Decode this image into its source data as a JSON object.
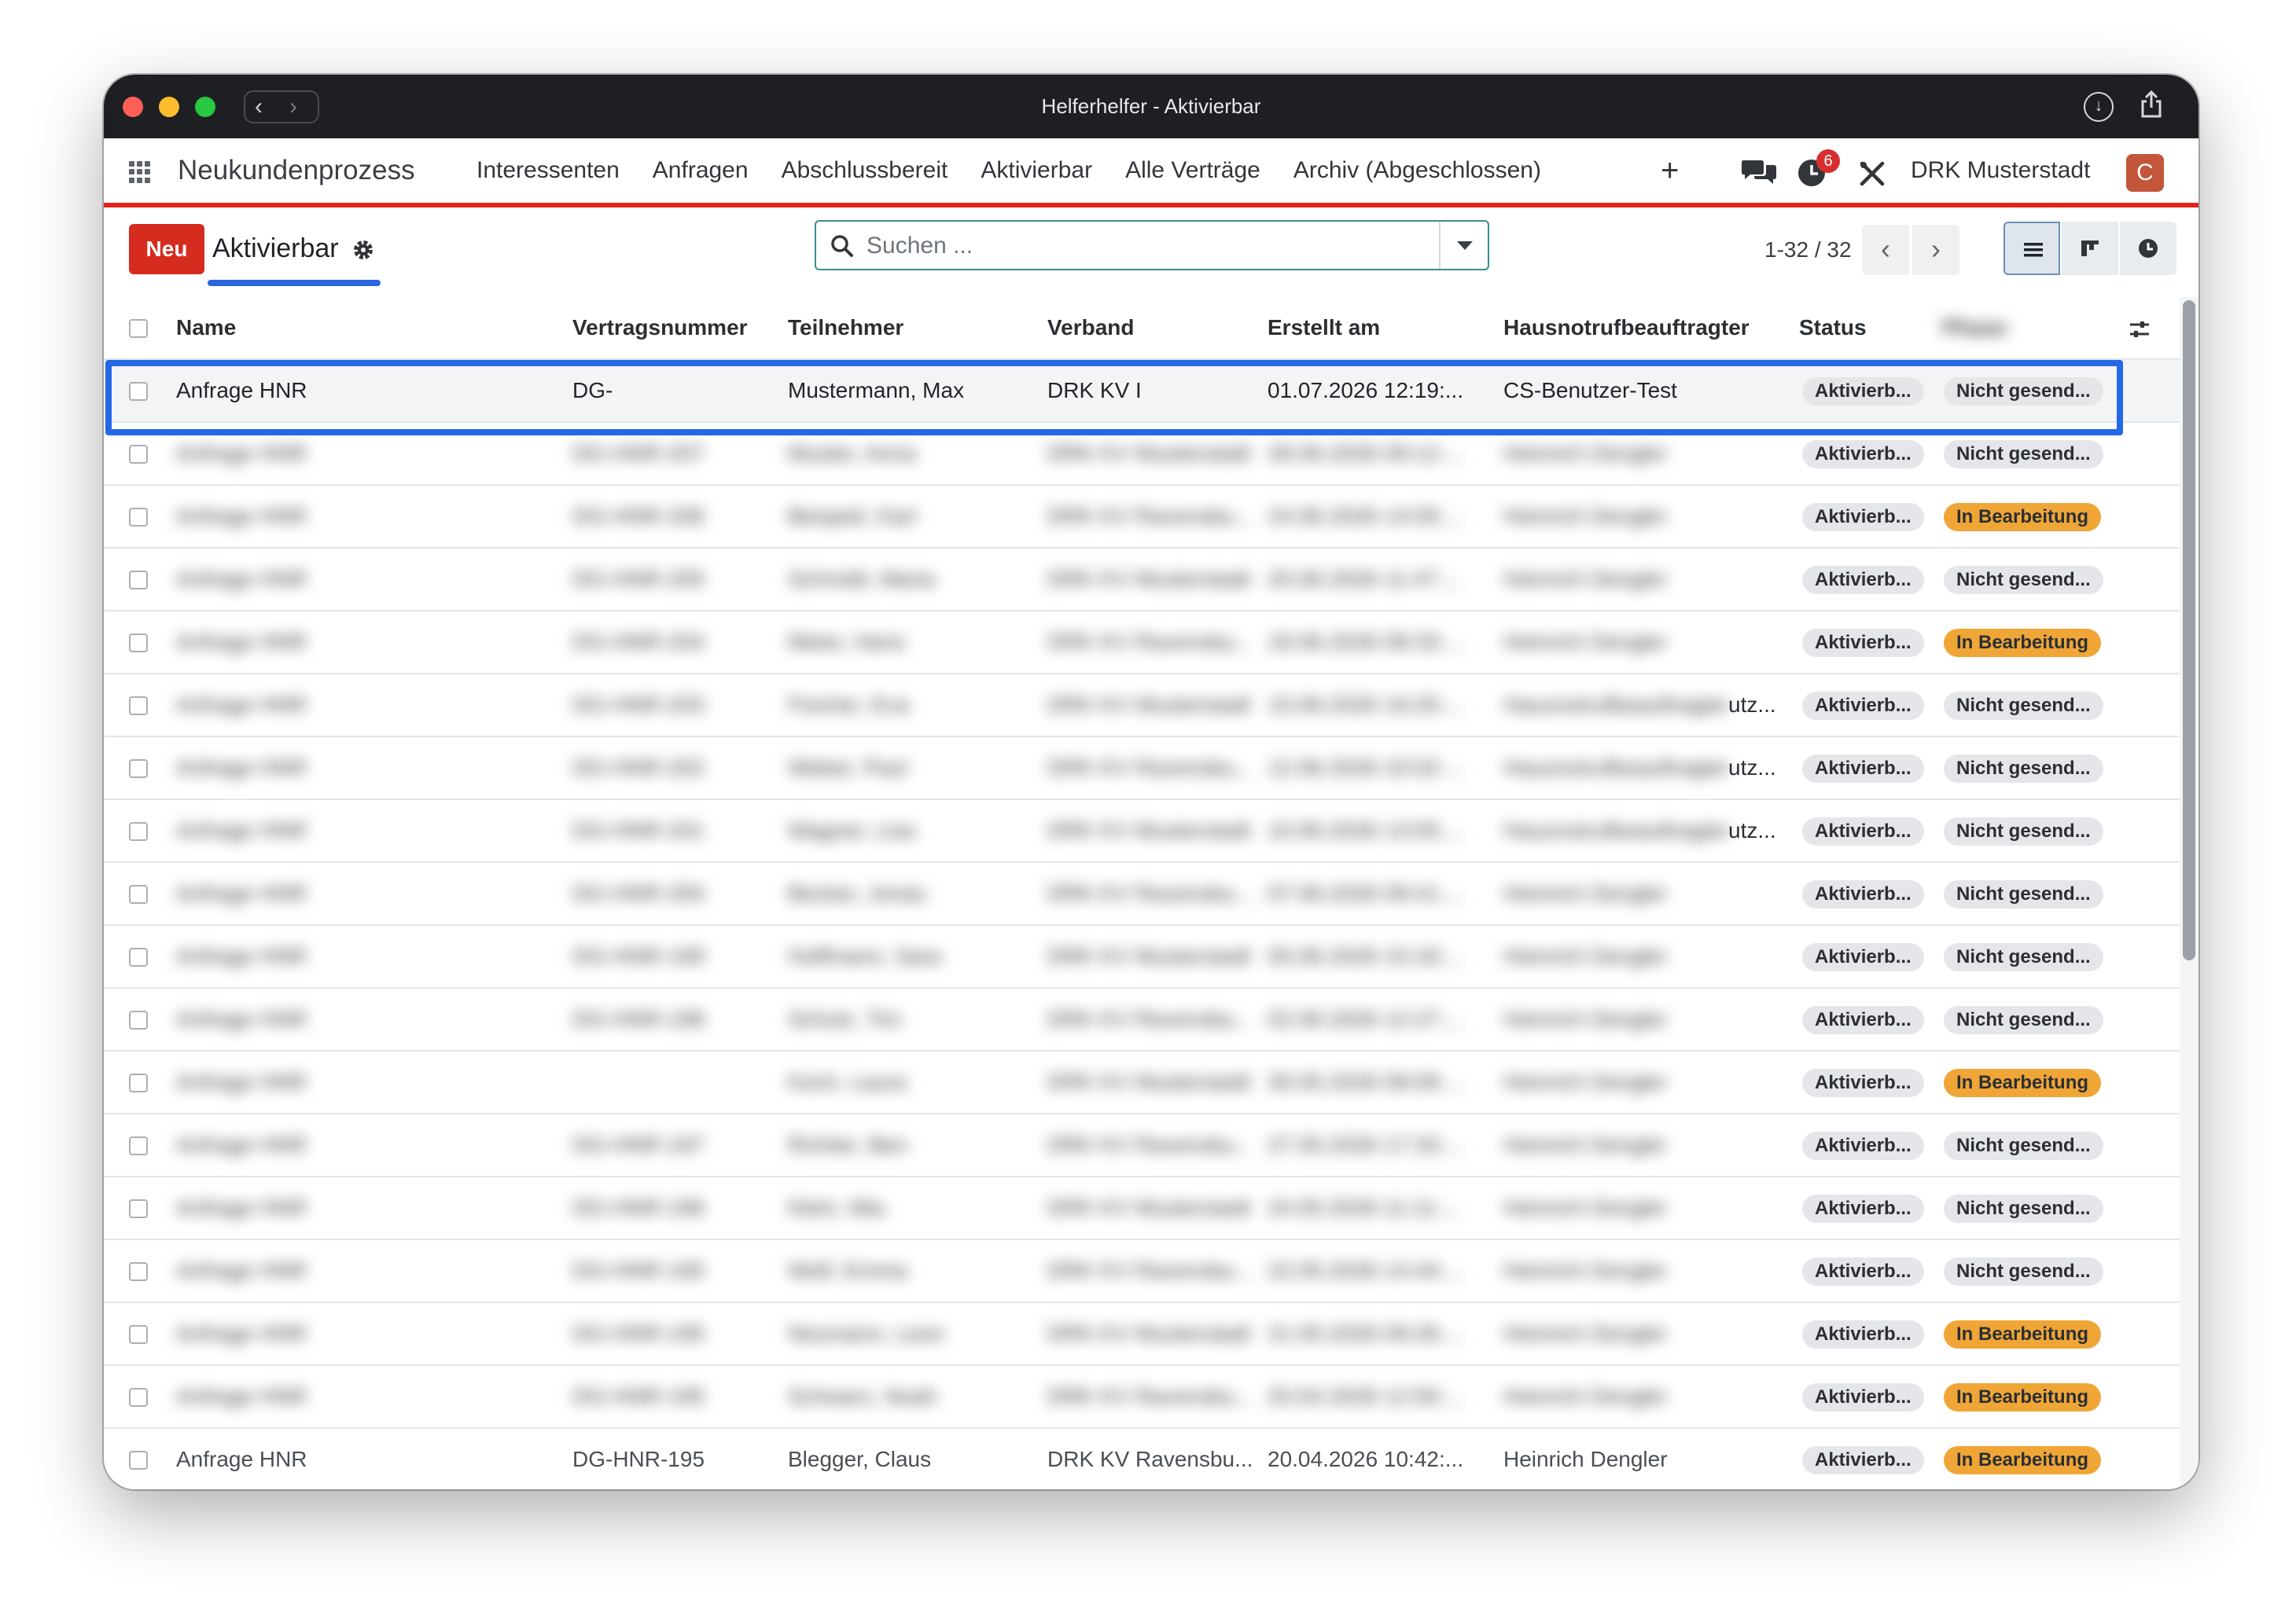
{
  "window": {
    "title": "Helferhelfer - Aktivierbar"
  },
  "navbar": {
    "brand": "Neukundenprozess",
    "menu": [
      "Interessenten",
      "Anfragen",
      "Abschlussbereit",
      "Aktivierbar",
      "Alle Verträge",
      "Archiv (Abgeschlossen)"
    ],
    "plus": "+",
    "activity_count": "6",
    "company": "DRK Musterstadt",
    "avatar_initial": "C"
  },
  "control": {
    "new_button": "Neu",
    "breadcrumb": "Aktivierbar",
    "search_placeholder": "Suchen ...",
    "pager": "1-32 / 32"
  },
  "table": {
    "headers": {
      "name": "Name",
      "contract": "Vertragsnummer",
      "participant": "Teilnehmer",
      "association": "Verband",
      "created": "Erstellt am",
      "officer": "Hausnotrufbeauftragter",
      "status": "Status"
    },
    "rows": [
      {
        "name": "Anfrage HNR",
        "contract": "DG-",
        "participant": "Mustermann, Max",
        "association": "DRK KV I",
        "created": "01.07.2026 12:19:...",
        "officer": "CS-Benutzer-Test",
        "trunc": "",
        "status": "Aktivierb...",
        "state": "Nicht gesend...",
        "state_color": "grey"
      },
      {
        "name": "Anfrage HNR",
        "contract": "DG-HNR-207",
        "participant": "Muster, Anna",
        "association": "DRK KV Musterstadt",
        "created": "28.06.2026 09:12:...",
        "officer": "Heinrich Dengler",
        "trunc": "",
        "status": "Aktivierb...",
        "state": "Nicht gesend...",
        "state_color": "grey"
      },
      {
        "name": "Anfrage HNR",
        "contract": "DG-HNR-206",
        "participant": "Beispiel, Karl",
        "association": "DRK KV Ravensbu...",
        "created": "24.06.2026 14:05:...",
        "officer": "Heinrich Dengler",
        "trunc": "",
        "status": "Aktivierb...",
        "state": "In Bearbeitung",
        "state_color": "orange"
      },
      {
        "name": "Anfrage HNR",
        "contract": "DG-HNR-205",
        "participant": "Schmidt, Maria",
        "association": "DRK KV Musterstadt",
        "created": "20.06.2026 11:47:...",
        "officer": "Heinrich Dengler",
        "trunc": "",
        "status": "Aktivierb...",
        "state": "Nicht gesend...",
        "state_color": "grey"
      },
      {
        "name": "Anfrage HNR",
        "contract": "DG-HNR-204",
        "participant": "Meier, Hans",
        "association": "DRK KV Ravensbu...",
        "created": "18.06.2026 08:33:...",
        "officer": "Heinrich Dengler",
        "trunc": "",
        "status": "Aktivierb...",
        "state": "In Bearbeitung",
        "state_color": "orange"
      },
      {
        "name": "Anfrage HNR",
        "contract": "DG-HNR-203",
        "participant": "Fischer, Eva",
        "association": "DRK KV Musterstadt",
        "created": "15.06.2026 16:20:...",
        "officer": "Hausnotrufbeauftragter",
        "trunc": "utz...",
        "status": "Aktivierb...",
        "state": "Nicht gesend...",
        "state_color": "grey"
      },
      {
        "name": "Anfrage HNR",
        "contract": "DG-HNR-202",
        "participant": "Weber, Paul",
        "association": "DRK KV Ravensbu...",
        "created": "12.06.2026 10:02:...",
        "officer": "Hausnotrufbeauftragter",
        "trunc": "utz...",
        "status": "Aktivierb...",
        "state": "Nicht gesend...",
        "state_color": "grey"
      },
      {
        "name": "Anfrage HNR",
        "contract": "DG-HNR-201",
        "participant": "Wagner, Lisa",
        "association": "DRK KV Musterstadt",
        "created": "10.06.2026 13:55:...",
        "officer": "Hausnotrufbeauftragter",
        "trunc": "utz...",
        "status": "Aktivierb...",
        "state": "Nicht gesend...",
        "state_color": "grey"
      },
      {
        "name": "Anfrage HNR",
        "contract": "DG-HNR-200",
        "participant": "Becker, Jonas",
        "association": "DRK KV Ravensbu...",
        "created": "07.06.2026 09:41:...",
        "officer": "Heinrich Dengler",
        "trunc": "",
        "status": "Aktivierb...",
        "state": "Nicht gesend...",
        "state_color": "grey"
      },
      {
        "name": "Anfrage HNR",
        "contract": "DG-HNR-199",
        "participant": "Hoffmann, Sara",
        "association": "DRK KV Musterstadt",
        "created": "05.06.2026 15:18:...",
        "officer": "Heinrich Dengler",
        "trunc": "",
        "status": "Aktivierb...",
        "state": "Nicht gesend...",
        "state_color": "grey"
      },
      {
        "name": "Anfrage HNR",
        "contract": "DG-HNR-198",
        "participant": "Schulz, Tim",
        "association": "DRK KV Ravensbu...",
        "created": "02.06.2026 12:27:...",
        "officer": "Heinrich Dengler",
        "trunc": "",
        "status": "Aktivierb...",
        "state": "Nicht gesend...",
        "state_color": "grey"
      },
      {
        "name": "Anfrage HNR",
        "contract": "",
        "participant": "Koch, Laura",
        "association": "DRK KV Musterstadt",
        "created": "30.05.2026 08:09:...",
        "officer": "Heinrich Dengler",
        "trunc": "",
        "status": "Aktivierb...",
        "state": "In Bearbeitung",
        "state_color": "orange"
      },
      {
        "name": "Anfrage HNR",
        "contract": "DG-HNR-197",
        "participant": "Richter, Ben",
        "association": "DRK KV Ravensbu...",
        "created": "27.05.2026 17:33:...",
        "officer": "Heinrich Dengler",
        "trunc": "",
        "status": "Aktivierb...",
        "state": "Nicht gesend...",
        "state_color": "grey"
      },
      {
        "name": "Anfrage HNR",
        "contract": "DG-HNR-196",
        "participant": "Klein, Mia",
        "association": "DRK KV Musterstadt",
        "created": "24.05.2026 11:11:...",
        "officer": "Heinrich Dengler",
        "trunc": "",
        "status": "Aktivierb...",
        "state": "Nicht gesend...",
        "state_color": "grey"
      },
      {
        "name": "Anfrage HNR",
        "contract": "DG-HNR-195",
        "participant": "Wolf, Emma",
        "association": "DRK KV Ravensbu...",
        "created": "22.05.2026 14:44:...",
        "officer": "Heinrich Dengler",
        "trunc": "",
        "status": "Aktivierb...",
        "state": "Nicht gesend...",
        "state_color": "grey"
      },
      {
        "name": "Anfrage HNR",
        "contract": "DG-HNR-195",
        "participant": "Neumann, Leon",
        "association": "DRK KV Musterstadt",
        "created": "21.05.2026 09:26:...",
        "officer": "Heinrich Dengler",
        "trunc": "",
        "status": "Aktivierb...",
        "state": "In Bearbeitung",
        "state_color": "orange"
      },
      {
        "name": "Anfrage HNR",
        "contract": "DG-HNR-195",
        "participant": "Schwarz, Noah",
        "association": "DRK KV Ravensbu...",
        "created": "20.04.2026 12:50:...",
        "officer": "Heinrich Dengler",
        "trunc": "",
        "status": "Aktivierb...",
        "state": "In Bearbeitung",
        "state_color": "orange"
      },
      {
        "name": "Anfrage HNR",
        "contract": "DG-HNR-195",
        "participant": "Blegger, Claus",
        "association": "DRK KV Ravensbu...",
        "created": "20.04.2026 10:42:...",
        "officer": "Heinrich Dengler",
        "trunc": "",
        "status": "Aktivierb...",
        "state": "In Bearbeitung",
        "state_color": "orange"
      }
    ]
  }
}
